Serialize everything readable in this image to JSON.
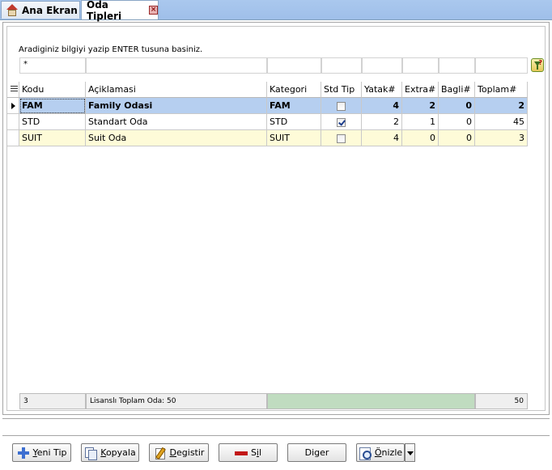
{
  "tabs": [
    {
      "label": "Ana Ekran",
      "icon": "home-icon",
      "active": false
    },
    {
      "label": "Oda Tipleri",
      "icon": "close-icon",
      "active": true
    }
  ],
  "search": {
    "hint": "Aradiginiz bilgiyi yazip ENTER tusuna basiniz.",
    "filter_values": [
      "*",
      "",
      "",
      "",
      "",
      "",
      "",
      "",
      ""
    ]
  },
  "grid": {
    "columns": [
      "Kodu",
      "Açiklamasi",
      "Kategori",
      "Std Tip",
      "Yatak#",
      "Extra#",
      "Bagli#",
      "Toplam#"
    ],
    "rows": [
      {
        "kodu": "FAM",
        "aciklama": "Family Odasi",
        "kategori": "FAM",
        "std_tip": false,
        "yatak": "4",
        "extra": "2",
        "bagli": "0",
        "toplam": "2"
      },
      {
        "kodu": "STD",
        "aciklama": "Standart Oda",
        "kategori": "STD",
        "std_tip": true,
        "yatak": "2",
        "extra": "1",
        "bagli": "0",
        "toplam": "45"
      },
      {
        "kodu": "SUIT",
        "aciklama": "Suit Oda",
        "kategori": "SUIT",
        "std_tip": false,
        "yatak": "4",
        "extra": "0",
        "bagli": "0",
        "toplam": "3"
      }
    ],
    "selected_row": 0
  },
  "footer": {
    "record_count": "3",
    "license_text": "Lisanslı Toplam Oda: 50",
    "total": "50"
  },
  "toolbar": {
    "new_label_u": "Y",
    "new_label_rest": "eni Tip",
    "copy_label_u": "K",
    "copy_label_rest": "opyala",
    "edit_label_u": "D",
    "edit_label_rest": "egistir",
    "delete_label_pre": "S",
    "delete_label_u": "i",
    "delete_label_rest": "l",
    "other_label": "Diger",
    "preview_label_u": "Ö",
    "preview_label_rest": "nizle"
  },
  "colors": {
    "tab_strip": "#9fbfe9",
    "selected_row": "#b6cff0",
    "alt_row": "#fefbd8",
    "footer_green": "#c0dcc0"
  }
}
